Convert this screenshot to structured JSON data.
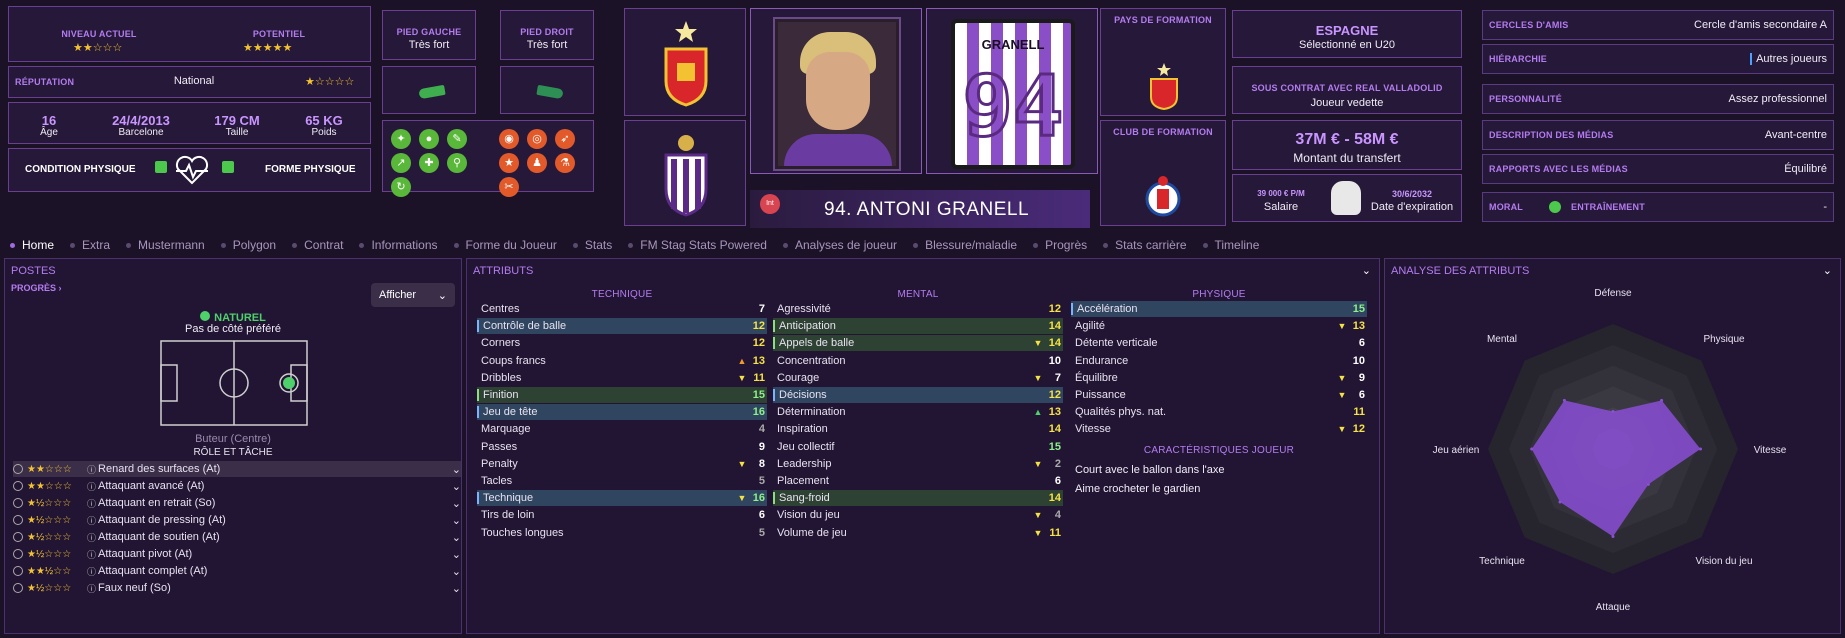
{
  "header": {
    "niveau_actuel_label": "NIVEAU ACTUEL",
    "niveau_actuel_stars": "★★☆☆☆",
    "potentiel_label": "POTENTIEL",
    "potentiel_stars": "★★★★★",
    "reputation_label": "RÉPUTATION",
    "reputation_value": "National",
    "reputation_stars": "★☆☆☆☆",
    "age_value": "16",
    "age_label": "Âge",
    "birth_value": "24/4/2013",
    "birth_place": "Barcelone",
    "height_value": "179 CM",
    "height_label": "Taille",
    "weight_value": "65 KG",
    "weight_label": "Poids",
    "condition_label": "CONDITION PHYSIQUE",
    "forme_label": "FORME PHYSIQUE",
    "pied_gauche_label": "PIED GAUCHE",
    "pied_gauche_value": "Très fort",
    "pied_droit_label": "PIED DROIT",
    "pied_droit_value": "Très fort",
    "player_name": "94. ANTONI GRANELL",
    "int_badge": "Int",
    "shirt_name": "GRANELL",
    "shirt_number": "94",
    "pays_formation_label": "PAYS DE FORMATION",
    "club_formation_label": "CLUB DE FORMATION",
    "nation": "ESPAGNE",
    "nation_sub": "Sélectionné en U20",
    "contract_label": "SOUS CONTRAT AVEC REAL VALLADOLID",
    "contract_role": "Joueur vedette",
    "transfer_value": "37M € - 58M €",
    "transfer_label": "Montant du transfert",
    "salary_value": "39 000 € P/M",
    "salary_label": "Salaire",
    "expiry_value": "30/6/2032",
    "expiry_label": "Date d'expiration",
    "cercles_label": "CERCLES D'AMIS",
    "cercles_value": "Cercle d'amis secondaire A",
    "hierarchie_label": "HIÉRARCHIE",
    "hierarchie_value": "Autres joueurs",
    "personnalite_label": "PERSONNALITÉ",
    "personnalite_value": "Assez professionnel",
    "medias_desc_label": "DESCRIPTION DES MÉDIAS",
    "medias_desc_value": "Avant-centre",
    "rapports_label": "RAPPORTS AVEC LES MÉDIAS",
    "rapports_value": "Équilibré",
    "moral_label": "MORAL",
    "entrainement_label": "ENTRAÎNEMENT",
    "entrainement_value": "-"
  },
  "tabs": [
    "Home",
    "Extra",
    "Mustermann",
    "Polygon",
    "Contrat",
    "Informations",
    "Forme du Joueur",
    "Stats",
    "FM Stag Stats Powered",
    "Analyses de joueur",
    "Blessure/maladie",
    "Progrès",
    "Stats carrière",
    "Timeline"
  ],
  "postes": {
    "title": "POSTES",
    "progres": "PROGRÈS",
    "afficher": "Afficher",
    "naturel": "NATUREL",
    "side": "Pas de côté préféré",
    "position": "Buteur (Centre)",
    "role_title": "RÔLE ET TÂCHE",
    "roles": [
      {
        "stars": "★★☆☆☆",
        "name": "Renard des surfaces (At)"
      },
      {
        "stars": "★★☆☆☆",
        "name": "Attaquant avancé (At)"
      },
      {
        "stars": "★½☆☆☆",
        "name": "Attaquant en retrait (So)"
      },
      {
        "stars": "★½☆☆☆",
        "name": "Attaquant de pressing (At)"
      },
      {
        "stars": "★½☆☆☆",
        "name": "Attaquant de soutien (At)"
      },
      {
        "stars": "★½☆☆☆",
        "name": "Attaquant pivot (At)"
      },
      {
        "stars": "★★½☆☆",
        "name": "Attaquant complet (At)"
      },
      {
        "stars": "★½☆☆☆",
        "name": "Faux neuf (So)"
      }
    ]
  },
  "attributs": {
    "title": "ATTRIBUTS",
    "technique_label": "TECHNIQUE",
    "mental_label": "MENTAL",
    "physique_label": "PHYSIQUE",
    "technique": [
      {
        "n": "Centres",
        "v": "7",
        "a": ""
      },
      {
        "n": "Contrôle de balle",
        "v": "12",
        "a": "",
        "h": "blue"
      },
      {
        "n": "Corners",
        "v": "12",
        "a": ""
      },
      {
        "n": "Coups francs",
        "v": "13",
        "a": "▲o"
      },
      {
        "n": "Dribbles",
        "v": "11",
        "a": "▼"
      },
      {
        "n": "Finition",
        "v": "15",
        "a": "",
        "h": "green"
      },
      {
        "n": "Jeu de tête",
        "v": "16",
        "a": "",
        "h": "blue"
      },
      {
        "n": "Marquage",
        "v": "4",
        "a": ""
      },
      {
        "n": "Passes",
        "v": "9",
        "a": ""
      },
      {
        "n": "Penalty",
        "v": "8",
        "a": "▼"
      },
      {
        "n": "Tacles",
        "v": "5",
        "a": ""
      },
      {
        "n": "Technique",
        "v": "16",
        "a": "▼",
        "h": "blue"
      },
      {
        "n": "Tirs de loin",
        "v": "6",
        "a": ""
      },
      {
        "n": "Touches longues",
        "v": "5",
        "a": ""
      }
    ],
    "mental": [
      {
        "n": "Agressivité",
        "v": "12",
        "a": ""
      },
      {
        "n": "Anticipation",
        "v": "14",
        "a": "",
        "h": "green"
      },
      {
        "n": "Appels de balle",
        "v": "14",
        "a": "▼",
        "h": "green"
      },
      {
        "n": "Concentration",
        "v": "10",
        "a": ""
      },
      {
        "n": "Courage",
        "v": "7",
        "a": "▼"
      },
      {
        "n": "Décisions",
        "v": "12",
        "a": "",
        "h": "blue"
      },
      {
        "n": "Détermination",
        "v": "13",
        "a": "▲"
      },
      {
        "n": "Inspiration",
        "v": "14",
        "a": ""
      },
      {
        "n": "Jeu collectif",
        "v": "15",
        "a": ""
      },
      {
        "n": "Leadership",
        "v": "2",
        "a": "▼"
      },
      {
        "n": "Placement",
        "v": "6",
        "a": ""
      },
      {
        "n": "Sang-froid",
        "v": "14",
        "a": "",
        "h": "green"
      },
      {
        "n": "Vision du jeu",
        "v": "4",
        "a": "▼"
      },
      {
        "n": "Volume de jeu",
        "v": "11",
        "a": "▼"
      }
    ],
    "physique": [
      {
        "n": "Accélération",
        "v": "15",
        "a": "",
        "h": "blue"
      },
      {
        "n": "Agilité",
        "v": "13",
        "a": "▼"
      },
      {
        "n": "Détente verticale",
        "v": "6",
        "a": ""
      },
      {
        "n": "Endurance",
        "v": "10",
        "a": ""
      },
      {
        "n": "Équilibre",
        "v": "9",
        "a": "▼"
      },
      {
        "n": "Puissance",
        "v": "6",
        "a": "▼"
      },
      {
        "n": "Qualités phys. nat.",
        "v": "11",
        "a": ""
      },
      {
        "n": "Vitesse",
        "v": "12",
        "a": "▼"
      }
    ],
    "carac_label": "CARACTÉRISTIQUES JOUEUR",
    "carac": [
      "Court avec le ballon dans l'axe",
      "Aime crocheter le gardien"
    ]
  },
  "analyse": {
    "title": "ANALYSE DES ATTRIBUTS",
    "axes": [
      "Défense",
      "Physique",
      "Vitesse",
      "Vision du jeu",
      "Attaque",
      "Technique",
      "Jeu aérien",
      "Mental"
    ]
  },
  "chart_data": {
    "type": "radar",
    "categories": [
      "Défense",
      "Physique",
      "Vitesse",
      "Vision du jeu",
      "Attaque",
      "Technique",
      "Jeu aérien",
      "Mental"
    ],
    "values": [
      6,
      11,
      14,
      8,
      14,
      12,
      13,
      11
    ],
    "ylim": [
      0,
      20
    ],
    "color": "#8a4fd6"
  },
  "colors": {
    "accent": "#b47cf0",
    "bg": "#1b1227",
    "star": "#f2c232"
  }
}
